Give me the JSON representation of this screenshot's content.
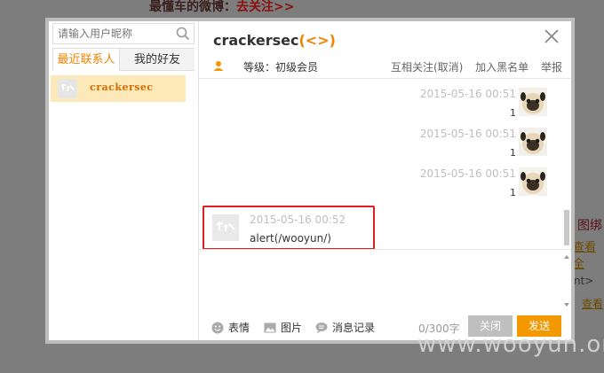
{
  "background": {
    "top_text": "最懂车的微博：",
    "top_link": "去关注>>",
    "right_text_1": "图绑",
    "right_text_2": "查看全",
    "right_text_3": "nt>",
    "right_text_4": "查看"
  },
  "watermark": "www.wooyun.org",
  "sidebar": {
    "search_placeholder": "请输入用户昵称",
    "tabs": [
      {
        "label": "最近联系人",
        "active": true
      },
      {
        "label": "我的好友",
        "active": false
      }
    ],
    "contacts": [
      {
        "name": "crackersec"
      }
    ]
  },
  "header": {
    "name": "crackersec",
    "name_tag": "(<>)",
    "level_label": "等级：初级会员",
    "actions": [
      "互相关注(取消)",
      "加入黑名单",
      "举报"
    ]
  },
  "messages": [
    {
      "direction": "out",
      "time": "2015-05-16 00:51",
      "text": "1"
    },
    {
      "direction": "out",
      "time": "2015-05-16 00:51",
      "text": "1"
    },
    {
      "direction": "out",
      "time": "2015-05-16 00:51",
      "text": "1"
    },
    {
      "direction": "in",
      "time": "2015-05-16 00:52",
      "text": "alert(/wooyun/)"
    }
  ],
  "toolbar": {
    "emoji_label": "表情",
    "image_label": "图片",
    "history_label": "消息记录",
    "counter": "0/300字",
    "close_label": "关闭",
    "send_label": "发送"
  },
  "colors": {
    "accent": "#f39800",
    "highlight_border": "#e02020",
    "selected_contact_bg": "#fde8b8"
  }
}
